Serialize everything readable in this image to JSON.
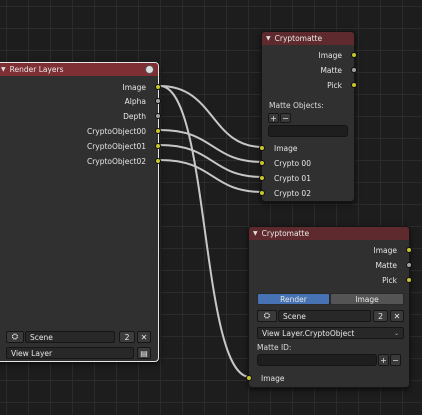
{
  "colors": {
    "header": "#7d2f34",
    "socket_color": "#c7c729",
    "socket_float": "#a1a1a1",
    "active_tab": "#4772b3"
  },
  "render_layers": {
    "title": "Render Layers",
    "outputs": [
      "Image",
      "Alpha",
      "Depth",
      "CryptoObject00",
      "CryptoObject01",
      "CryptoObject02"
    ],
    "scene_value": "Scene",
    "scene_users": "2",
    "close_symbol": "✕",
    "view_layer_value": "View Layer"
  },
  "crypto_top": {
    "title": "Cryptomatte",
    "outputs": [
      "Image",
      "Matte",
      "Pick"
    ],
    "matte_objects_label": "Matte Objects:",
    "add_symbol": "+",
    "remove_symbol": "−",
    "inputs": [
      "Image",
      "Crypto 00",
      "Crypto 01",
      "Crypto 02"
    ]
  },
  "crypto_bottom": {
    "title": "Cryptomatte",
    "outputs": [
      "Image",
      "Matte",
      "Pick"
    ],
    "tab_render": "Render",
    "tab_image": "Image",
    "scene_value": "Scene",
    "scene_users": "2",
    "close_symbol": "✕",
    "layer_dropdown": "View Layer.CryptoObject",
    "matte_id_label": "Matte ID:",
    "add_symbol": "+",
    "remove_symbol": "−",
    "input_image": "Image"
  }
}
